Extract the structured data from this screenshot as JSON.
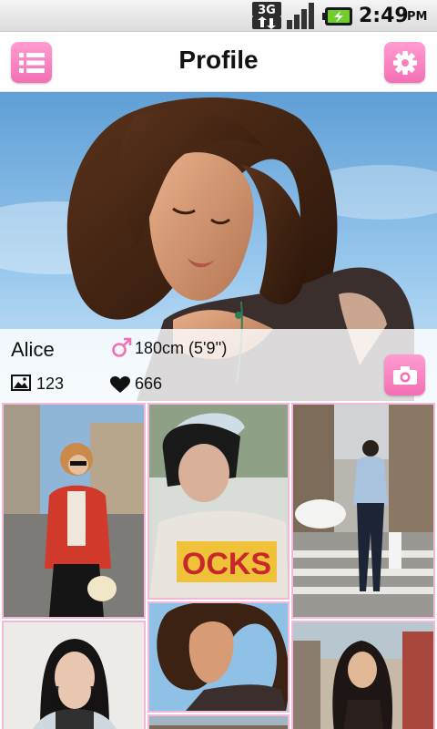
{
  "status_bar": {
    "network": "3G",
    "time": "2:49",
    "ampm": "PM"
  },
  "header": {
    "title": "Profile"
  },
  "profile": {
    "name": "Alice",
    "height": "180cm (5'9'')",
    "photo_count": "123",
    "like_count": "666"
  },
  "colors": {
    "accent": "#f46fb6",
    "tile_border": "#f4b8d9"
  },
  "icons": [
    "list-icon",
    "gear-icon",
    "male-icon",
    "picture-icon",
    "heart-icon",
    "camera-icon"
  ],
  "grid": {
    "photos": [
      "red-jacket-photo",
      "bandana-photo",
      "street-crosswalk-photo",
      "portrait-black-hair-photo",
      "wavy-hair-photo",
      "street-long-hair-photo"
    ],
    "shirt_text": "OCKS"
  }
}
